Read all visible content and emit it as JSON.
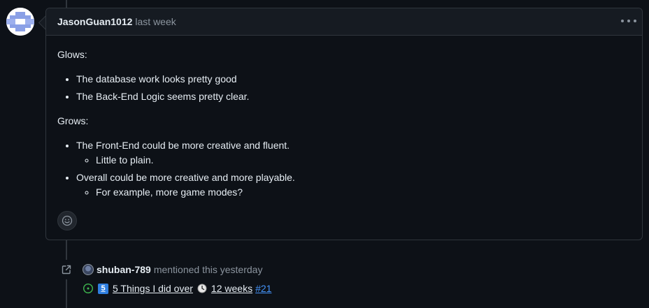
{
  "comment": {
    "author": "JasonGuan1012",
    "timestamp": "last week",
    "body": {
      "glows_heading": "Glows:",
      "glows_items": [
        "The database work looks pretty good",
        "The Back-End Logic seems pretty clear."
      ],
      "grows_heading": "Grows:",
      "grows_items": [
        {
          "text": "The Front-End could be more creative and fluent.",
          "sub": "Little to plain."
        },
        {
          "text": "Overall could be more creative and more playable.",
          "sub": "For example, more game modes?"
        }
      ]
    },
    "icons": {
      "menu": "kebab-horizontal-icon",
      "reaction": "smiley-icon"
    }
  },
  "event": {
    "user": "shuban-789",
    "action": "mentioned this yesterday",
    "icon": "cross-reference-icon",
    "reference": {
      "title_part1": "5 Things I did over",
      "title_part2": "12 weeks",
      "number": "#21",
      "status_icon": "issue-open-icon"
    }
  },
  "colors": {
    "background": "#0d1117",
    "border": "#30363d",
    "header_bg": "#161b22",
    "muted_text": "#8b949e",
    "link_blue": "#4493f8",
    "open_green": "#3fb950"
  }
}
